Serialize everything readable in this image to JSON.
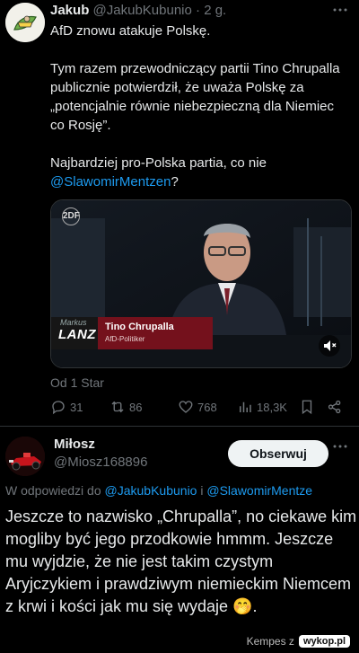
{
  "tweet": {
    "author_name": "Jakub",
    "author_handle": "@JakubKubunio",
    "separator": " · ",
    "time": "2 g.",
    "more_icon": "more-dots-icon",
    "line1": "AfD znowu atakuje Polskę.",
    "line2": "Tym razem przewodniczący partii Tino Chrupalla publicznie potwierdził, że uważa Polskę za „potencjalnie równie niebezpieczną dla Niemiec co Rosję”.",
    "line3_text": "Najbardziej pro-Polska partia, co nie ",
    "line3_mention": "@SlawomirMentzen",
    "line3_end": "?",
    "media": {
      "channel_logo": "2DF",
      "show_name_small": "Markus",
      "show_name": "LANZ",
      "guest_name": "Tino Chrupalla",
      "guest_role": "AfD-Politiker",
      "mute_icon": "mute-icon"
    },
    "translation_label": "Od 1 Star",
    "stats": {
      "replies": "31",
      "retweets": "86",
      "likes": "768",
      "views": "18,3K"
    }
  },
  "reply": {
    "author_name": "Miłosz",
    "author_handle": "@Miosz168896",
    "follow_label": "Obserwuj",
    "reply_prefix": "W odpowiedzi do ",
    "reply_mention1": "@JakubKubunio",
    "reply_and": " i ",
    "reply_mention2": "@SlawomirMentze",
    "text": "Jeszcze to nazwisko „Chrupalla”, no ciekawe kim mogliby być jego przodkowie hmmm. Jeszcze mu wyjdzie, że nie jest takim czystym Aryjczykiem i prawdziwym niemieckim Niemcem z krwi i kości jak mu się wydaje 🤭."
  },
  "watermark": {
    "text": "Kempes z",
    "logo": "wykop.pl"
  },
  "colors": {
    "background": "#000000",
    "text": "#e7e9ea",
    "secondary": "#71767b",
    "link": "#1d9bf0",
    "divider": "#2f3336"
  }
}
